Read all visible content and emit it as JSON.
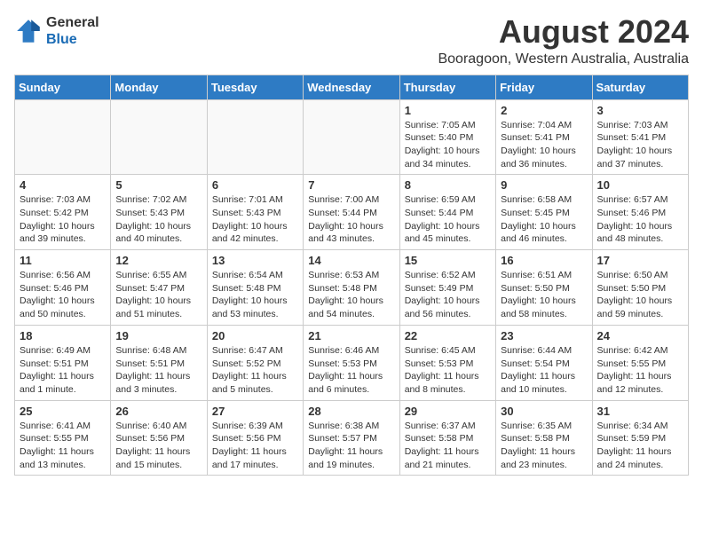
{
  "header": {
    "logo_line1": "General",
    "logo_line2": "Blue",
    "month_year": "August 2024",
    "location": "Booragoon, Western Australia, Australia"
  },
  "weekdays": [
    "Sunday",
    "Monday",
    "Tuesday",
    "Wednesday",
    "Thursday",
    "Friday",
    "Saturday"
  ],
  "weeks": [
    [
      {
        "day": "",
        "info": ""
      },
      {
        "day": "",
        "info": ""
      },
      {
        "day": "",
        "info": ""
      },
      {
        "day": "",
        "info": ""
      },
      {
        "day": "1",
        "info": "Sunrise: 7:05 AM\nSunset: 5:40 PM\nDaylight: 10 hours\nand 34 minutes."
      },
      {
        "day": "2",
        "info": "Sunrise: 7:04 AM\nSunset: 5:41 PM\nDaylight: 10 hours\nand 36 minutes."
      },
      {
        "day": "3",
        "info": "Sunrise: 7:03 AM\nSunset: 5:41 PM\nDaylight: 10 hours\nand 37 minutes."
      }
    ],
    [
      {
        "day": "4",
        "info": "Sunrise: 7:03 AM\nSunset: 5:42 PM\nDaylight: 10 hours\nand 39 minutes."
      },
      {
        "day": "5",
        "info": "Sunrise: 7:02 AM\nSunset: 5:43 PM\nDaylight: 10 hours\nand 40 minutes."
      },
      {
        "day": "6",
        "info": "Sunrise: 7:01 AM\nSunset: 5:43 PM\nDaylight: 10 hours\nand 42 minutes."
      },
      {
        "day": "7",
        "info": "Sunrise: 7:00 AM\nSunset: 5:44 PM\nDaylight: 10 hours\nand 43 minutes."
      },
      {
        "day": "8",
        "info": "Sunrise: 6:59 AM\nSunset: 5:44 PM\nDaylight: 10 hours\nand 45 minutes."
      },
      {
        "day": "9",
        "info": "Sunrise: 6:58 AM\nSunset: 5:45 PM\nDaylight: 10 hours\nand 46 minutes."
      },
      {
        "day": "10",
        "info": "Sunrise: 6:57 AM\nSunset: 5:46 PM\nDaylight: 10 hours\nand 48 minutes."
      }
    ],
    [
      {
        "day": "11",
        "info": "Sunrise: 6:56 AM\nSunset: 5:46 PM\nDaylight: 10 hours\nand 50 minutes."
      },
      {
        "day": "12",
        "info": "Sunrise: 6:55 AM\nSunset: 5:47 PM\nDaylight: 10 hours\nand 51 minutes."
      },
      {
        "day": "13",
        "info": "Sunrise: 6:54 AM\nSunset: 5:48 PM\nDaylight: 10 hours\nand 53 minutes."
      },
      {
        "day": "14",
        "info": "Sunrise: 6:53 AM\nSunset: 5:48 PM\nDaylight: 10 hours\nand 54 minutes."
      },
      {
        "day": "15",
        "info": "Sunrise: 6:52 AM\nSunset: 5:49 PM\nDaylight: 10 hours\nand 56 minutes."
      },
      {
        "day": "16",
        "info": "Sunrise: 6:51 AM\nSunset: 5:50 PM\nDaylight: 10 hours\nand 58 minutes."
      },
      {
        "day": "17",
        "info": "Sunrise: 6:50 AM\nSunset: 5:50 PM\nDaylight: 10 hours\nand 59 minutes."
      }
    ],
    [
      {
        "day": "18",
        "info": "Sunrise: 6:49 AM\nSunset: 5:51 PM\nDaylight: 11 hours\nand 1 minute."
      },
      {
        "day": "19",
        "info": "Sunrise: 6:48 AM\nSunset: 5:51 PM\nDaylight: 11 hours\nand 3 minutes."
      },
      {
        "day": "20",
        "info": "Sunrise: 6:47 AM\nSunset: 5:52 PM\nDaylight: 11 hours\nand 5 minutes."
      },
      {
        "day": "21",
        "info": "Sunrise: 6:46 AM\nSunset: 5:53 PM\nDaylight: 11 hours\nand 6 minutes."
      },
      {
        "day": "22",
        "info": "Sunrise: 6:45 AM\nSunset: 5:53 PM\nDaylight: 11 hours\nand 8 minutes."
      },
      {
        "day": "23",
        "info": "Sunrise: 6:44 AM\nSunset: 5:54 PM\nDaylight: 11 hours\nand 10 minutes."
      },
      {
        "day": "24",
        "info": "Sunrise: 6:42 AM\nSunset: 5:55 PM\nDaylight: 11 hours\nand 12 minutes."
      }
    ],
    [
      {
        "day": "25",
        "info": "Sunrise: 6:41 AM\nSunset: 5:55 PM\nDaylight: 11 hours\nand 13 minutes."
      },
      {
        "day": "26",
        "info": "Sunrise: 6:40 AM\nSunset: 5:56 PM\nDaylight: 11 hours\nand 15 minutes."
      },
      {
        "day": "27",
        "info": "Sunrise: 6:39 AM\nSunset: 5:56 PM\nDaylight: 11 hours\nand 17 minutes."
      },
      {
        "day": "28",
        "info": "Sunrise: 6:38 AM\nSunset: 5:57 PM\nDaylight: 11 hours\nand 19 minutes."
      },
      {
        "day": "29",
        "info": "Sunrise: 6:37 AM\nSunset: 5:58 PM\nDaylight: 11 hours\nand 21 minutes."
      },
      {
        "day": "30",
        "info": "Sunrise: 6:35 AM\nSunset: 5:58 PM\nDaylight: 11 hours\nand 23 minutes."
      },
      {
        "day": "31",
        "info": "Sunrise: 6:34 AM\nSunset: 5:59 PM\nDaylight: 11 hours\nand 24 minutes."
      }
    ]
  ]
}
